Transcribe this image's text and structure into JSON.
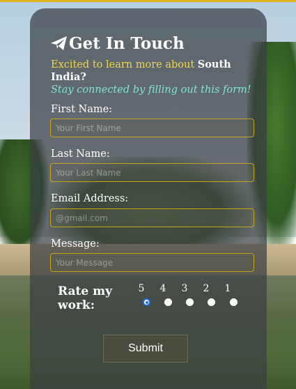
{
  "title": "Get In Touch",
  "intro": {
    "prefix": "Excited to learn more about ",
    "highlight": "South India?",
    "subtitle": "Stay connected by filling out this form!"
  },
  "fields": {
    "first_name": {
      "label": "First Name:",
      "placeholder": "Your First Name"
    },
    "last_name": {
      "label": "Last Name:",
      "placeholder": "Your Last Name"
    },
    "email": {
      "label": "Email Address:",
      "placeholder": "@gmail.com"
    },
    "message": {
      "label": "Message:",
      "placeholder": "Your Message"
    }
  },
  "rating": {
    "label": "Rate my work:",
    "options": [
      "5",
      "4",
      "3",
      "2",
      "1"
    ],
    "selected": "5"
  },
  "submit_label": "Submit",
  "icons": {
    "title_icon": "paper-plane-icon"
  },
  "colors": {
    "accent_yellow": "#f2d64a",
    "subtitle_teal": "#7fe8c8",
    "field_border": "#c9a21a",
    "radio_selected": "#1a6fe0"
  }
}
